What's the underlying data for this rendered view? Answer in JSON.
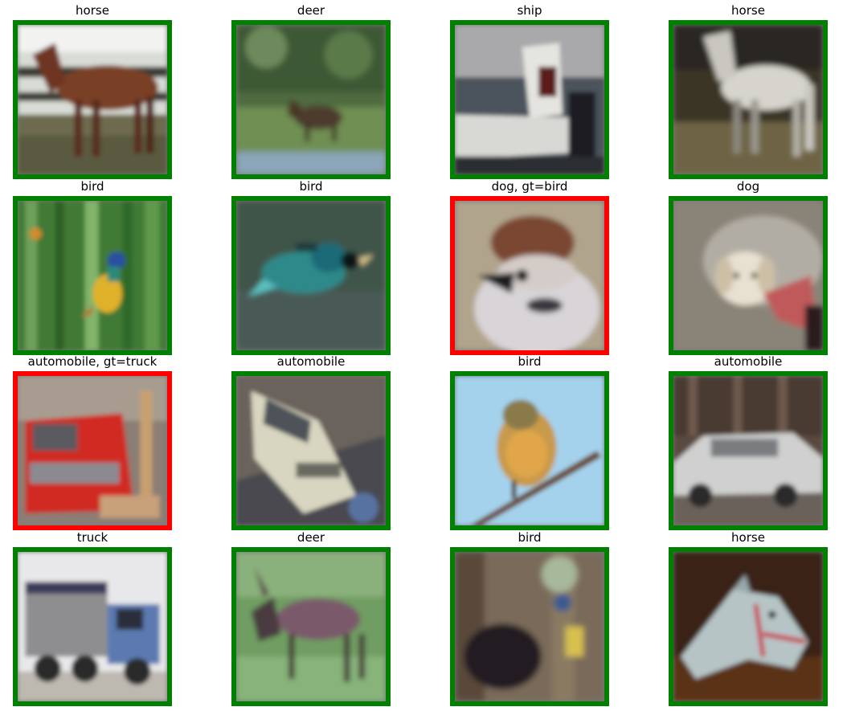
{
  "colors": {
    "correct_border": "#008000",
    "wrong_border": "#ff0000",
    "caption_text": "#000000",
    "background": "#ffffff"
  },
  "tiles": [
    {
      "label": "horse",
      "correct": true,
      "subject": "brown horse in front of fence"
    },
    {
      "label": "deer",
      "correct": true,
      "subject": "deer grazing in green field"
    },
    {
      "label": "ship",
      "correct": true,
      "subject": "white boat on water"
    },
    {
      "label": "horse",
      "correct": true,
      "subject": "white horse in stable"
    },
    {
      "label": "bird",
      "correct": true,
      "subject": "colorful bird in tall grass"
    },
    {
      "label": "bird",
      "correct": true,
      "subject": "blue-green bird close-up"
    },
    {
      "label": "dog, gt=bird",
      "correct": false,
      "subject": "sparrow face close-up"
    },
    {
      "label": "dog",
      "correct": true,
      "subject": "white puppy on blanket"
    },
    {
      "label": "automobile, gt=truck",
      "correct": false,
      "subject": "red truck front"
    },
    {
      "label": "automobile",
      "correct": true,
      "subject": "white rally car"
    },
    {
      "label": "bird",
      "correct": true,
      "subject": "yellow bird on branch, blue sky"
    },
    {
      "label": "automobile",
      "correct": true,
      "subject": "silver hatchback car"
    },
    {
      "label": "truck",
      "correct": true,
      "subject": "blue dump truck"
    },
    {
      "label": "deer",
      "correct": true,
      "subject": "deer in grass"
    },
    {
      "label": "bird",
      "correct": true,
      "subject": "dark bird in forest"
    },
    {
      "label": "horse",
      "correct": true,
      "subject": "white horse head with red halter"
    }
  ]
}
